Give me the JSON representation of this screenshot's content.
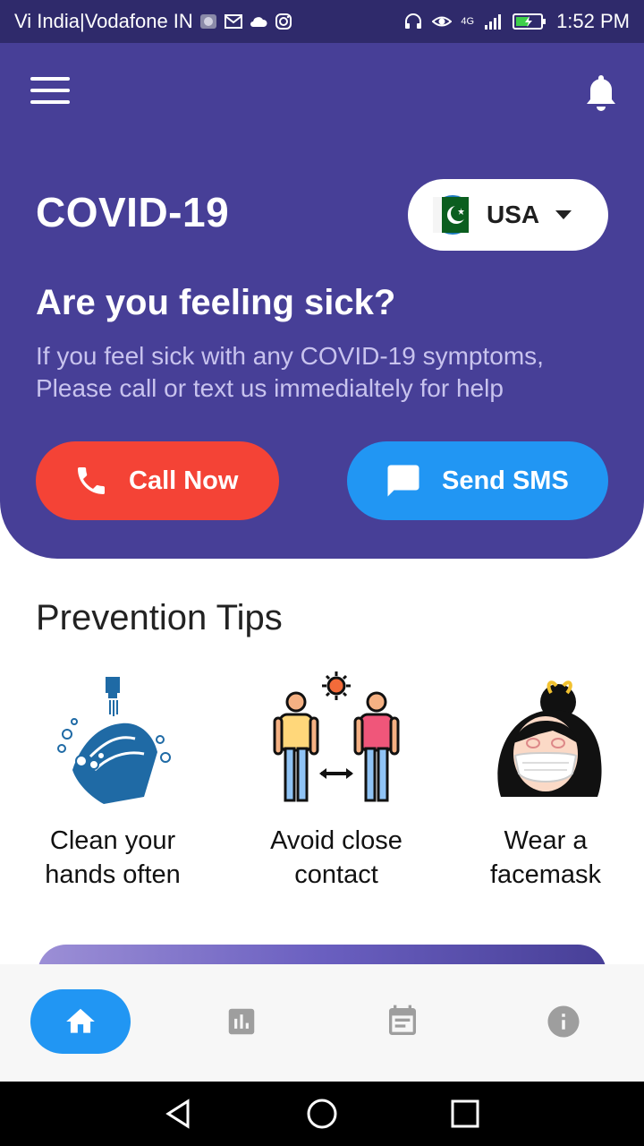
{
  "status_bar": {
    "carrier": "Vi India|Vodafone IN",
    "network": "4G",
    "time": "1:52 PM"
  },
  "header": {
    "title": "COVID-19",
    "country": "USA",
    "sick_title": "Are you feeling sick?",
    "sick_text": "If you feel sick with any COVID-19 symptoms, Please call or text us immedialtely for help",
    "call_label": "Call Now",
    "sms_label": "Send SMS"
  },
  "tips": {
    "title": "Prevention Tips",
    "items": [
      {
        "label_line1": "Clean your",
        "label_line2": "hands often",
        "icon": "hand-wash-icon"
      },
      {
        "label_line1": "Avoid close",
        "label_line2": "contact",
        "icon": "distance-icon"
      },
      {
        "label_line1": "Wear a",
        "label_line2": "facemask",
        "icon": "facemask-icon"
      }
    ]
  },
  "nav": {
    "items": [
      "home-icon",
      "stats-icon",
      "calendar-icon",
      "info-icon"
    ],
    "active": "home"
  },
  "colors": {
    "header_bg": "#473f97",
    "status_bg": "#2f2a6b",
    "call": "#f44336",
    "sms": "#2196f3",
    "nav_active": "#2196f3"
  }
}
